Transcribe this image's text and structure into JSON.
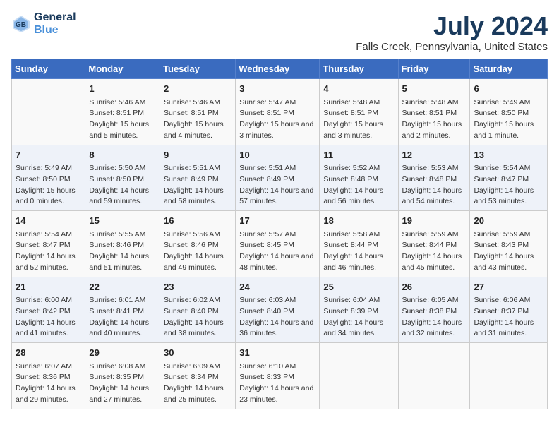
{
  "logo": {
    "line1": "General",
    "line2": "Blue"
  },
  "title": "July 2024",
  "subtitle": "Falls Creek, Pennsylvania, United States",
  "headers": [
    "Sunday",
    "Monday",
    "Tuesday",
    "Wednesday",
    "Thursday",
    "Friday",
    "Saturday"
  ],
  "weeks": [
    [
      {
        "date": "",
        "sunrise": "",
        "sunset": "",
        "daylight": ""
      },
      {
        "date": "1",
        "sunrise": "Sunrise: 5:46 AM",
        "sunset": "Sunset: 8:51 PM",
        "daylight": "Daylight: 15 hours and 5 minutes."
      },
      {
        "date": "2",
        "sunrise": "Sunrise: 5:46 AM",
        "sunset": "Sunset: 8:51 PM",
        "daylight": "Daylight: 15 hours and 4 minutes."
      },
      {
        "date": "3",
        "sunrise": "Sunrise: 5:47 AM",
        "sunset": "Sunset: 8:51 PM",
        "daylight": "Daylight: 15 hours and 3 minutes."
      },
      {
        "date": "4",
        "sunrise": "Sunrise: 5:48 AM",
        "sunset": "Sunset: 8:51 PM",
        "daylight": "Daylight: 15 hours and 3 minutes."
      },
      {
        "date": "5",
        "sunrise": "Sunrise: 5:48 AM",
        "sunset": "Sunset: 8:51 PM",
        "daylight": "Daylight: 15 hours and 2 minutes."
      },
      {
        "date": "6",
        "sunrise": "Sunrise: 5:49 AM",
        "sunset": "Sunset: 8:50 PM",
        "daylight": "Daylight: 15 hours and 1 minute."
      }
    ],
    [
      {
        "date": "7",
        "sunrise": "Sunrise: 5:49 AM",
        "sunset": "Sunset: 8:50 PM",
        "daylight": "Daylight: 15 hours and 0 minutes."
      },
      {
        "date": "8",
        "sunrise": "Sunrise: 5:50 AM",
        "sunset": "Sunset: 8:50 PM",
        "daylight": "Daylight: 14 hours and 59 minutes."
      },
      {
        "date": "9",
        "sunrise": "Sunrise: 5:51 AM",
        "sunset": "Sunset: 8:49 PM",
        "daylight": "Daylight: 14 hours and 58 minutes."
      },
      {
        "date": "10",
        "sunrise": "Sunrise: 5:51 AM",
        "sunset": "Sunset: 8:49 PM",
        "daylight": "Daylight: 14 hours and 57 minutes."
      },
      {
        "date": "11",
        "sunrise": "Sunrise: 5:52 AM",
        "sunset": "Sunset: 8:48 PM",
        "daylight": "Daylight: 14 hours and 56 minutes."
      },
      {
        "date": "12",
        "sunrise": "Sunrise: 5:53 AM",
        "sunset": "Sunset: 8:48 PM",
        "daylight": "Daylight: 14 hours and 54 minutes."
      },
      {
        "date": "13",
        "sunrise": "Sunrise: 5:54 AM",
        "sunset": "Sunset: 8:47 PM",
        "daylight": "Daylight: 14 hours and 53 minutes."
      }
    ],
    [
      {
        "date": "14",
        "sunrise": "Sunrise: 5:54 AM",
        "sunset": "Sunset: 8:47 PM",
        "daylight": "Daylight: 14 hours and 52 minutes."
      },
      {
        "date": "15",
        "sunrise": "Sunrise: 5:55 AM",
        "sunset": "Sunset: 8:46 PM",
        "daylight": "Daylight: 14 hours and 51 minutes."
      },
      {
        "date": "16",
        "sunrise": "Sunrise: 5:56 AM",
        "sunset": "Sunset: 8:46 PM",
        "daylight": "Daylight: 14 hours and 49 minutes."
      },
      {
        "date": "17",
        "sunrise": "Sunrise: 5:57 AM",
        "sunset": "Sunset: 8:45 PM",
        "daylight": "Daylight: 14 hours and 48 minutes."
      },
      {
        "date": "18",
        "sunrise": "Sunrise: 5:58 AM",
        "sunset": "Sunset: 8:44 PM",
        "daylight": "Daylight: 14 hours and 46 minutes."
      },
      {
        "date": "19",
        "sunrise": "Sunrise: 5:59 AM",
        "sunset": "Sunset: 8:44 PM",
        "daylight": "Daylight: 14 hours and 45 minutes."
      },
      {
        "date": "20",
        "sunrise": "Sunrise: 5:59 AM",
        "sunset": "Sunset: 8:43 PM",
        "daylight": "Daylight: 14 hours and 43 minutes."
      }
    ],
    [
      {
        "date": "21",
        "sunrise": "Sunrise: 6:00 AM",
        "sunset": "Sunset: 8:42 PM",
        "daylight": "Daylight: 14 hours and 41 minutes."
      },
      {
        "date": "22",
        "sunrise": "Sunrise: 6:01 AM",
        "sunset": "Sunset: 8:41 PM",
        "daylight": "Daylight: 14 hours and 40 minutes."
      },
      {
        "date": "23",
        "sunrise": "Sunrise: 6:02 AM",
        "sunset": "Sunset: 8:40 PM",
        "daylight": "Daylight: 14 hours and 38 minutes."
      },
      {
        "date": "24",
        "sunrise": "Sunrise: 6:03 AM",
        "sunset": "Sunset: 8:40 PM",
        "daylight": "Daylight: 14 hours and 36 minutes."
      },
      {
        "date": "25",
        "sunrise": "Sunrise: 6:04 AM",
        "sunset": "Sunset: 8:39 PM",
        "daylight": "Daylight: 14 hours and 34 minutes."
      },
      {
        "date": "26",
        "sunrise": "Sunrise: 6:05 AM",
        "sunset": "Sunset: 8:38 PM",
        "daylight": "Daylight: 14 hours and 32 minutes."
      },
      {
        "date": "27",
        "sunrise": "Sunrise: 6:06 AM",
        "sunset": "Sunset: 8:37 PM",
        "daylight": "Daylight: 14 hours and 31 minutes."
      }
    ],
    [
      {
        "date": "28",
        "sunrise": "Sunrise: 6:07 AM",
        "sunset": "Sunset: 8:36 PM",
        "daylight": "Daylight: 14 hours and 29 minutes."
      },
      {
        "date": "29",
        "sunrise": "Sunrise: 6:08 AM",
        "sunset": "Sunset: 8:35 PM",
        "daylight": "Daylight: 14 hours and 27 minutes."
      },
      {
        "date": "30",
        "sunrise": "Sunrise: 6:09 AM",
        "sunset": "Sunset: 8:34 PM",
        "daylight": "Daylight: 14 hours and 25 minutes."
      },
      {
        "date": "31",
        "sunrise": "Sunrise: 6:10 AM",
        "sunset": "Sunset: 8:33 PM",
        "daylight": "Daylight: 14 hours and 23 minutes."
      },
      {
        "date": "",
        "sunrise": "",
        "sunset": "",
        "daylight": ""
      },
      {
        "date": "",
        "sunrise": "",
        "sunset": "",
        "daylight": ""
      },
      {
        "date": "",
        "sunrise": "",
        "sunset": "",
        "daylight": ""
      }
    ]
  ]
}
